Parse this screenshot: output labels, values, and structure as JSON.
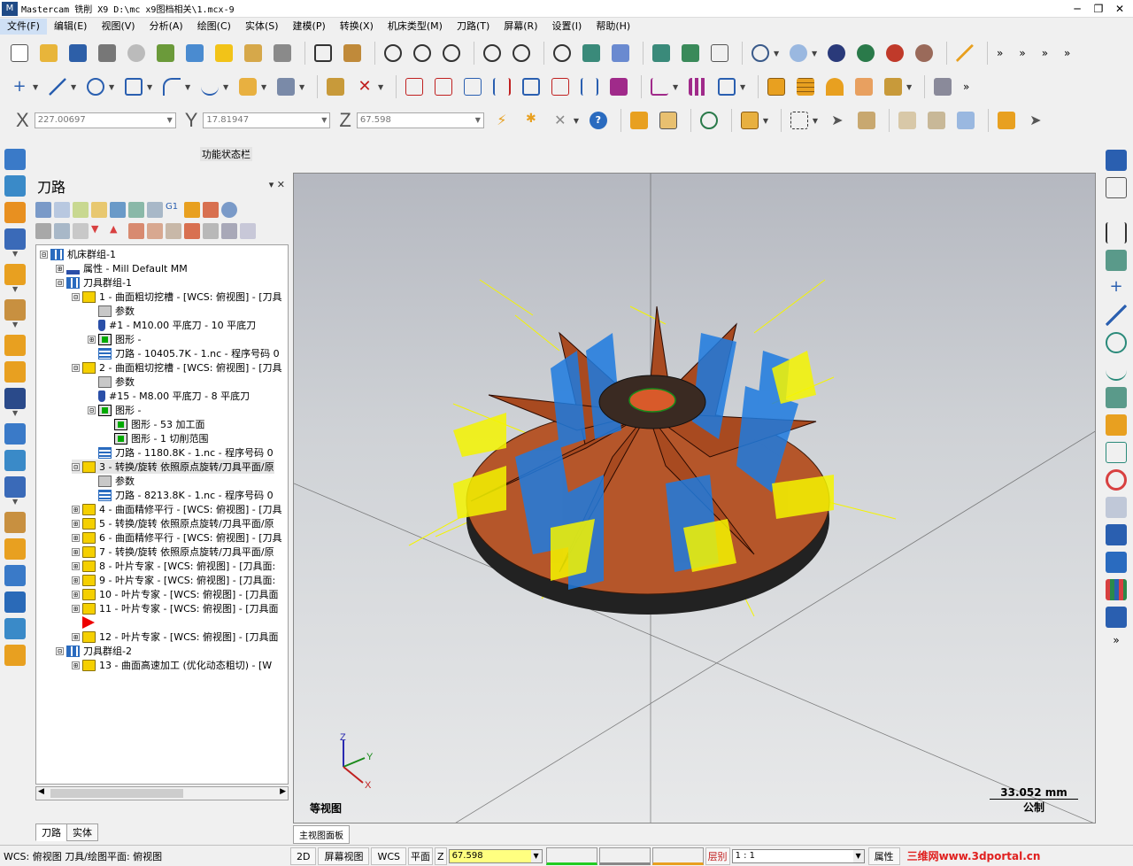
{
  "titlebar": {
    "title": "Mastercam 铣削 X9  D:\\mc x9图档相关\\1.mcx-9",
    "min": "─",
    "restore": "❐",
    "close": "✕"
  },
  "menu": [
    "文件(F)",
    "编辑(E)",
    "视图(V)",
    "分析(A)",
    "绘图(C)",
    "实体(S)",
    "建模(P)",
    "转换(X)",
    "机床类型(M)",
    "刀路(T)",
    "屏幕(R)",
    "设置(I)",
    "帮助(H)"
  ],
  "coords": {
    "x_label": "X",
    "x_value": "227.00697",
    "y_label": "Y",
    "y_value": "17.81947",
    "z_label": "Z",
    "z_value": "67.598"
  },
  "function_status": "功能状态栏",
  "panel": {
    "title": "刀路",
    "pin": "▾ ✕",
    "tabs": [
      "刀路",
      "实体"
    ]
  },
  "tree": [
    {
      "level": 0,
      "exp": "⊟",
      "icon": "group",
      "text": "机床群组-1"
    },
    {
      "level": 1,
      "exp": "⊞",
      "icon": "prop",
      "text": "属性 - Mill Default MM"
    },
    {
      "level": 1,
      "exp": "⊟",
      "icon": "group",
      "text": "刀具群组-1"
    },
    {
      "level": 2,
      "exp": "⊟",
      "icon": "folder-open",
      "text": "1 - 曲面粗切挖槽 - [WCS: 俯视图] - [刀具"
    },
    {
      "level": 3,
      "exp": "",
      "icon": "gear",
      "text": "参数"
    },
    {
      "level": 3,
      "exp": "",
      "icon": "tool",
      "text": "#1 - M10.00 平底刀 - 10 平底刀"
    },
    {
      "level": 3,
      "exp": "⊞",
      "icon": "geo",
      "text": "图形 -"
    },
    {
      "level": 3,
      "exp": "",
      "icon": "wave",
      "text": "刀路 - 10405.7K - 1.nc - 程序号码 0"
    },
    {
      "level": 2,
      "exp": "⊟",
      "icon": "folder-open",
      "text": "2 - 曲面粗切挖槽 - [WCS: 俯视图] - [刀具"
    },
    {
      "level": 3,
      "exp": "",
      "icon": "gear",
      "text": "参数"
    },
    {
      "level": 3,
      "exp": "",
      "icon": "tool",
      "text": "#15 - M8.00 平底刀 - 8 平底刀"
    },
    {
      "level": 3,
      "exp": "⊟",
      "icon": "geo",
      "text": "图形 -"
    },
    {
      "level": 4,
      "exp": "",
      "icon": "geo",
      "text": "图形 - 53 加工面"
    },
    {
      "level": 4,
      "exp": "",
      "icon": "geo",
      "text": "图形 - 1 切削范围"
    },
    {
      "level": 3,
      "exp": "",
      "icon": "wave",
      "text": "刀路 - 1180.8K - 1.nc - 程序号码 0"
    },
    {
      "level": 2,
      "exp": "⊟",
      "icon": "folder-open",
      "text": "3 - 转换/旋转 依照原点旋转/刀具平面/原"
    },
    {
      "level": 3,
      "exp": "",
      "icon": "gear",
      "text": "参数"
    },
    {
      "level": 3,
      "exp": "",
      "icon": "wave",
      "text": "刀路 - 8213.8K - 1.nc - 程序号码 0"
    },
    {
      "level": 2,
      "exp": "⊞",
      "icon": "folder",
      "text": "4 - 曲面精修平行 - [WCS: 俯视图] - [刀具"
    },
    {
      "level": 2,
      "exp": "⊞",
      "icon": "folder",
      "text": "5 - 转换/旋转 依照原点旋转/刀具平面/原"
    },
    {
      "level": 2,
      "exp": "⊞",
      "icon": "folder",
      "text": "6 - 曲面精修平行 - [WCS: 俯视图] - [刀具"
    },
    {
      "level": 2,
      "exp": "⊞",
      "icon": "folder",
      "text": "7 - 转换/旋转 依照原点旋转/刀具平面/原"
    },
    {
      "level": 2,
      "exp": "⊞",
      "icon": "folder",
      "text": "8 - 叶片专家 - [WCS: 俯视图] - [刀具面:"
    },
    {
      "level": 2,
      "exp": "⊞",
      "icon": "folder",
      "text": "9 - 叶片专家 - [WCS: 俯视图] - [刀具面:"
    },
    {
      "level": 2,
      "exp": "⊞",
      "icon": "folder",
      "text": "10 - 叶片专家 - [WCS: 俯视图] - [刀具面"
    },
    {
      "level": 2,
      "exp": "⊞",
      "icon": "folder",
      "text": "11 - 叶片专家 - [WCS: 俯视图] - [刀具面"
    },
    {
      "level": 2,
      "exp": "",
      "icon": "insert",
      "text": ""
    },
    {
      "level": 2,
      "exp": "⊞",
      "icon": "folder",
      "text": "12 - 叶片专家 - [WCS: 俯视图] - [刀具面"
    },
    {
      "level": 1,
      "exp": "⊟",
      "icon": "group",
      "text": "刀具群组-2"
    },
    {
      "level": 2,
      "exp": "⊞",
      "icon": "folder",
      "text": "13 - 曲面高速加工 (优化动态粗切) - [W"
    }
  ],
  "viewport": {
    "view_name": "等视图",
    "scale_value": "33.052 mm",
    "scale_unit": "公制",
    "axis_z": "Z",
    "axis_y": "Y",
    "axis_x": "X",
    "tab": "主视图面板"
  },
  "status": {
    "left": "WCS: 俯视图  刀具/绘图平面: 俯视图",
    "mode_2d": "2D",
    "screen_view": "屏幕视图",
    "wcs": "WCS",
    "plane": "平面",
    "z_label": "Z",
    "z_value": "67.598",
    "layer_label": "层别",
    "layer_value": "1 : 1",
    "attr": "属性",
    "watermark": "三维网www.3dportal.cn"
  },
  "colors": {
    "accent": "#1f4a86",
    "toolpath_blue": "#1e7be0",
    "toolpath_yellow": "#f4f400",
    "part_copper": "#c05a2a",
    "status_green": "#22cc22",
    "watermark_red": "#e0201f"
  }
}
